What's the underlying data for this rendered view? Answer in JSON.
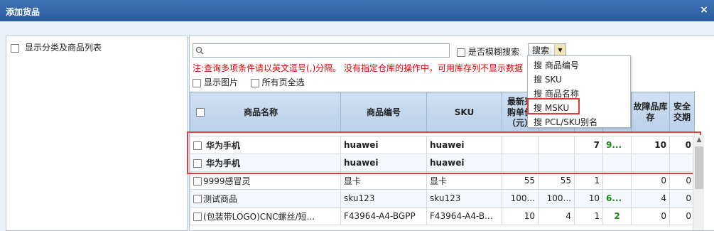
{
  "dialog": {
    "title": "添加货品",
    "close_icon": "×"
  },
  "left": {
    "show_category_label": "显示分类及商品列表"
  },
  "toolbar": {
    "search_placeholder": "",
    "fuzzy_label": "是否模糊搜索",
    "search_button": "搜索",
    "note": "注:查询多项条件请以英文逗号(,)分隔。 没有指定仓库的操作中，可用库存列不显示数据",
    "show_image_label": "显示图片",
    "select_all_pages_label": "所有页全选"
  },
  "search_menu": {
    "items": [
      "搜 商品编号",
      "搜 SKU",
      "搜 商品名称",
      "搜 MSKU",
      "搜 PCL/SKU别名"
    ]
  },
  "table": {
    "headers": [
      "商品名称",
      "商品编号",
      "SKU",
      "最新采购单价（元）",
      "",
      "",
      "",
      "故障品库存",
      "安全交期"
    ],
    "header_newest_lines": [
      "最新采",
      "购单价",
      "（元）"
    ],
    "rows": [
      {
        "name": "华为手机",
        "code": "huawei",
        "sku": "huawei",
        "price": "",
        "c5": "",
        "c6": "7",
        "c7": "9...",
        "fault": "10",
        "safe": "0"
      },
      {
        "name": "华为手机",
        "code": "huawei",
        "sku": "huawei",
        "price": "",
        "c5": "",
        "c6": "",
        "c7": "",
        "fault": "",
        "safe": ""
      },
      {
        "name": "9999感冒灵",
        "code": "显卡",
        "sku": "显卡",
        "price": "55",
        "c5": "55",
        "c6": "1",
        "c7": "",
        "fault": "0",
        "safe": "0"
      },
      {
        "name": "测试商品",
        "code": "sku123",
        "sku": "sku123",
        "price": "100...",
        "c5": "100...",
        "c6": "10",
        "c7": "6...",
        "fault": "4",
        "safe": "0"
      },
      {
        "name": "(包装带LOGO)CNC螺丝/短...",
        "code": "F43964-A4-BGPP",
        "sku": "F43964-A4-B...",
        "price": "10",
        "c5": "4",
        "c6": "1",
        "c7": "2",
        "fault": "0",
        "safe": "0"
      }
    ]
  },
  "colors": {
    "title_bar": "#2f63a8",
    "highlight": "#e53b3b",
    "note_text": "#e00000",
    "green_value": "#1a8a1a"
  }
}
